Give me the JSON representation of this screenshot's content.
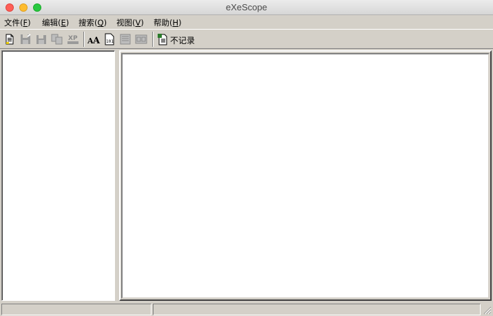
{
  "window": {
    "title": "eXeScope"
  },
  "menu": {
    "file": {
      "label": "文件(",
      "acc": "F",
      "tail": ")"
    },
    "edit": {
      "label": "编辑(",
      "acc": "E",
      "tail": ")"
    },
    "search": {
      "label": "搜索(",
      "acc": "Q",
      "tail": ")"
    },
    "view": {
      "label": "视图(",
      "acc": "V",
      "tail": ")"
    },
    "help": {
      "label": "帮助(",
      "acc": "H",
      "tail": ")"
    }
  },
  "toolbar": {
    "buttons": [
      {
        "icon": "open-file-icon",
        "enabled": true
      },
      {
        "icon": "save-icon",
        "enabled": false
      },
      {
        "icon": "save-as-icon",
        "enabled": false
      },
      {
        "icon": "copy-icon",
        "enabled": false
      },
      {
        "icon": "xp-manifest-icon",
        "enabled": false
      },
      {
        "icon": "font-icon",
        "enabled": true
      },
      {
        "icon": "binary-view-icon",
        "enabled": true
      },
      {
        "icon": "dialog-edit-icon",
        "enabled": false
      },
      {
        "icon": "form-icon",
        "enabled": false
      },
      {
        "icon": "log-icon",
        "enabled": true
      }
    ],
    "log_label": "不记录"
  },
  "statusbar": {
    "left": "",
    "right": ""
  },
  "colors": {
    "face": "#d4d0c8",
    "shadow": "#808080",
    "highlight": "#ffffff"
  }
}
